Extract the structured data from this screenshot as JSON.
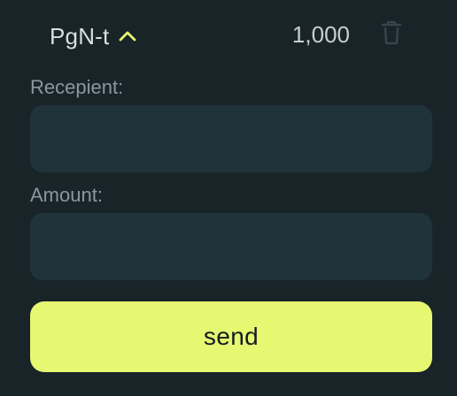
{
  "token": {
    "name": "PgN-t",
    "amount": "1,000",
    "chevron_icon": "chevron-up-icon",
    "delete_icon": "trash-icon",
    "accent_color": "#e6f872"
  },
  "form": {
    "recipient_label": "Recepient:",
    "recipient_value": "",
    "amount_label": "Amount:",
    "amount_value": ""
  },
  "actions": {
    "send_label": "send"
  },
  "colors": {
    "background": "#192429",
    "input_background": "#21333a",
    "button_background": "#e6f872",
    "label_text": "#8a979d"
  }
}
